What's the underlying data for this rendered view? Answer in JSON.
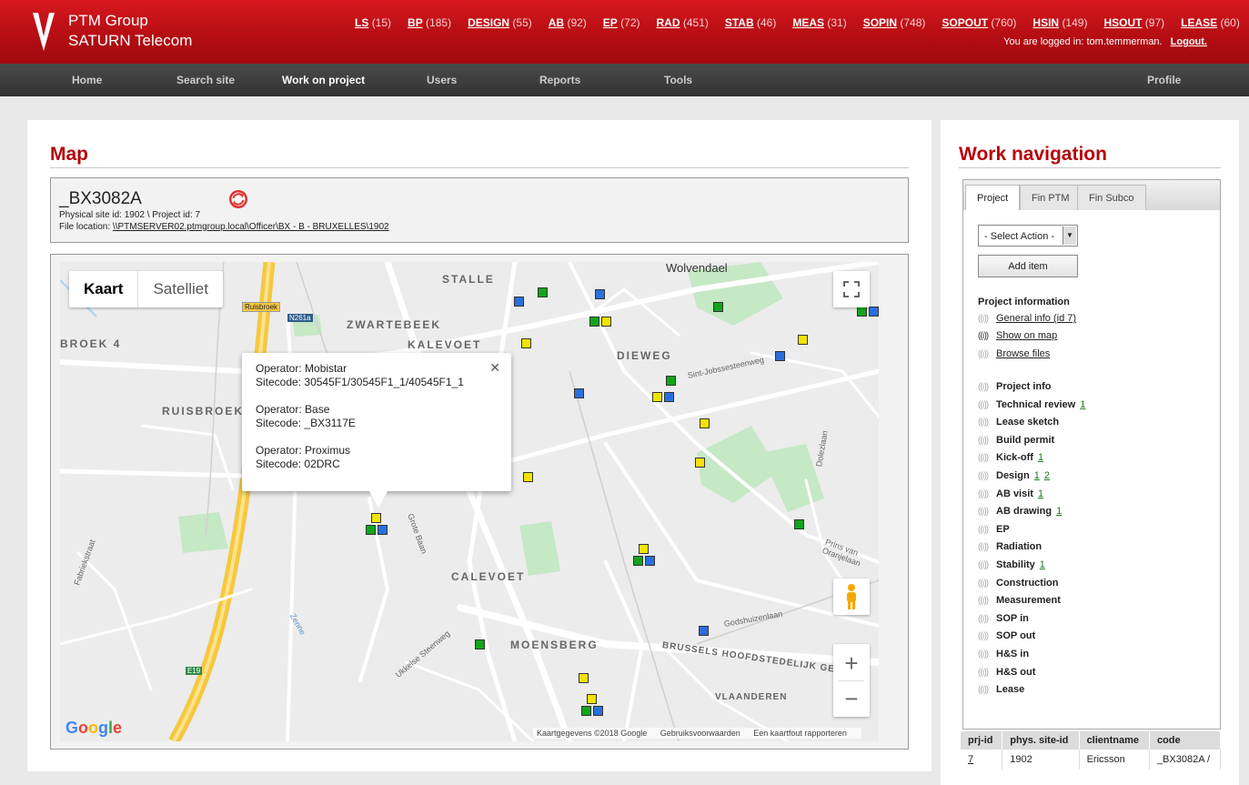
{
  "header": {
    "company": "PTM Group",
    "subtitle": "SATURN Telecom",
    "counts": [
      {
        "label": "LS",
        "count": "(15)"
      },
      {
        "label": "BP",
        "count": "(185)"
      },
      {
        "label": "DESIGN",
        "count": "(55)"
      },
      {
        "label": "AB",
        "count": "(92)"
      },
      {
        "label": "EP",
        "count": "(72)"
      },
      {
        "label": "RAD",
        "count": "(451)"
      },
      {
        "label": "STAB",
        "count": "(46)"
      },
      {
        "label": "MEAS",
        "count": "(31)"
      },
      {
        "label": "SOPIN",
        "count": "(748)"
      },
      {
        "label": "SOPOUT",
        "count": "(760)"
      },
      {
        "label": "HSIN",
        "count": "(149)"
      },
      {
        "label": "HSOUT",
        "count": "(97)"
      },
      {
        "label": "LEASE",
        "count": "(60)"
      }
    ],
    "logged_in_text": "You are logged in: tom.temmerman.",
    "logout_label": "Logout."
  },
  "nav": {
    "home": "Home",
    "search_site": "Search site",
    "work_on_project": "Work on project",
    "users": "Users",
    "reports": "Reports",
    "tools": "Tools",
    "profile": "Profile"
  },
  "map_panel": {
    "title": "Map",
    "site_code": "_BX3082A",
    "site_ids": "Physical site id: 1902 \\ Project id: 7",
    "file_location_label": "File location:",
    "file_location_link": "\\\\PTMSERVER02.ptmgroup.local\\Officer\\BX - B - BRUXELLES\\1902"
  },
  "map": {
    "type_map": "Kaart",
    "type_satellite": "Satelliet",
    "labels": {
      "stalle": "STALLE",
      "zwartebeek": "ZWARTEBEEK",
      "kalevoet": "KALEVOET",
      "dieweg": "DIEWEG",
      "broek": "BROEK 4",
      "ruisbroek": "RUISBROEK",
      "calevoet": "CALEVOET",
      "moensberg": "MOENSBERG",
      "wolvendael": "Wolvendael",
      "vlaanderen": "VLAANDEREN",
      "ruisbroek_sign": "Ruisbroek",
      "n261a": "N261a",
      "e19": "E19",
      "grote_baan": "Grote Baan",
      "fabriekstraat": "Fabriekstraat",
      "dolezlaan": "Dolezlaan",
      "brussels_hs": "BRUSSELS HOOFDSTEDELIJK GEWEST",
      "sint_jobs": "Sint-Jobssesteenweg",
      "prins": "Prins van Oranjelaan",
      "godshuizen": "Godshuizenlaan",
      "ukkelse": "Ukkelse Steenweg",
      "zenne": "Zenne"
    },
    "popup": {
      "entries": [
        {
          "operator_label": "Operator:",
          "operator": "Mobistar",
          "sitecode_label": "Sitecode:",
          "sitecode": "30545F1/30545F1_1/40545F1_1"
        },
        {
          "operator_label": "Operator:",
          "operator": "Base",
          "sitecode_label": "Sitecode:",
          "sitecode": "_BX3117E"
        },
        {
          "operator_label": "Operator:",
          "operator": "Proximus",
          "sitecode_label": "Sitecode:",
          "sitecode": "02DRC"
        }
      ]
    },
    "google_logo": "Google",
    "attribution": [
      "Kaartgegevens ©2018 Google",
      "Gebruiksvoorwaarden",
      "Een kaartfout rapporteren"
    ],
    "marker_colors": {
      "y": "#f2e300",
      "g": "#12a51c",
      "b": "#2a6fde"
    }
  },
  "work_nav": {
    "title": "Work navigation",
    "tabs": [
      "Project",
      "Fin PTM",
      "Fin Subco"
    ],
    "select_placeholder": "- Select Action -",
    "add_item": "Add item",
    "project_information": "Project information",
    "info_links": [
      "General info (id 7)",
      "Show on map",
      "Browse files"
    ],
    "phases": [
      {
        "name": "Project info",
        "links": []
      },
      {
        "name": "Technical review",
        "links": [
          "1"
        ]
      },
      {
        "name": "Lease sketch",
        "links": []
      },
      {
        "name": "Build permit",
        "links": []
      },
      {
        "name": "Kick-off",
        "links": [
          "1"
        ]
      },
      {
        "name": "Design",
        "links": [
          "1",
          "2"
        ]
      },
      {
        "name": "AB visit",
        "links": [
          "1"
        ]
      },
      {
        "name": "AB drawing",
        "links": [
          "1"
        ]
      },
      {
        "name": "EP",
        "links": []
      },
      {
        "name": "Radiation",
        "links": []
      },
      {
        "name": "Stability",
        "links": [
          "1"
        ]
      },
      {
        "name": "Construction",
        "links": []
      },
      {
        "name": "Measurement",
        "links": []
      },
      {
        "name": "SOP in",
        "links": []
      },
      {
        "name": "SOP out",
        "links": []
      },
      {
        "name": "H&S in",
        "links": []
      },
      {
        "name": "H&S out",
        "links": []
      },
      {
        "name": "Lease",
        "links": []
      }
    ]
  },
  "results_table": {
    "headers": [
      "prj-id",
      "phys. site-id",
      "clientname",
      "code"
    ],
    "rows": [
      [
        "7",
        "1902",
        "Ericsson",
        "_BX3082A /"
      ]
    ]
  }
}
